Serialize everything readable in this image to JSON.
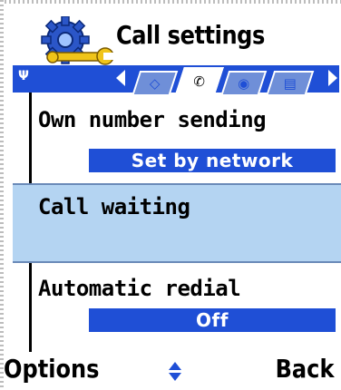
{
  "header": {
    "title": "Call settings",
    "icon": "settings-gear-wrench-icon",
    "signal_indicator": "Ψ"
  },
  "tabs": [
    {
      "icon": "phone-settings-icon",
      "glyph": "◇",
      "active": false
    },
    {
      "icon": "call-handset-icon",
      "glyph": "✆",
      "active": true
    },
    {
      "icon": "network-globe-icon",
      "glyph": "◉",
      "active": false
    },
    {
      "icon": "device-data-icon",
      "glyph": "▤",
      "active": false
    }
  ],
  "list": {
    "items": [
      {
        "label": "Own number sending",
        "value": "Set by network"
      },
      {
        "label": "Call waiting",
        "value": ""
      },
      {
        "label": "Automatic redial",
        "value": "Off"
      }
    ]
  },
  "softkeys": {
    "left": "Options",
    "right": "Back"
  },
  "colors": {
    "accent": "#1f4fd6",
    "highlight": "#b4d4f2",
    "background": "#ffffff"
  }
}
